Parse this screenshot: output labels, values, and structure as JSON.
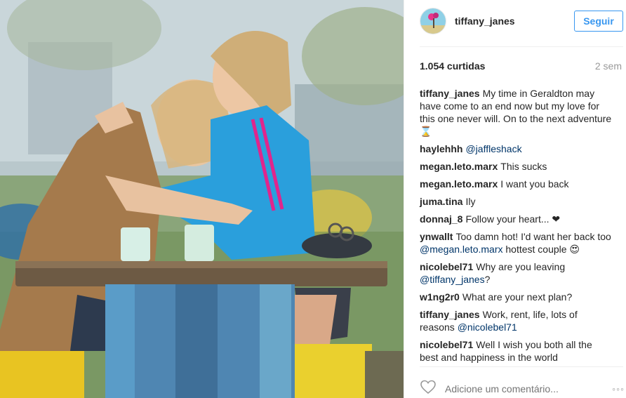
{
  "post": {
    "username": "tiffany_janes",
    "follow_label": "Seguir",
    "likes": "1.054 curtidas",
    "time": "2 sem",
    "comment_placeholder": "Adicione um comentário...",
    "more_label": "◦◦◦"
  },
  "icons": {
    "heart": "heart-outline-icon",
    "more": "more-options-icon"
  },
  "colors": {
    "follow": "#3897f0",
    "mention": "#003569",
    "muted": "#999999"
  },
  "comments": [
    {
      "user": "tiffany_janes",
      "text": "My time in Geraldton may have come to an end now but my love for this one never will. On to the next adventure ⌛",
      "mention": ""
    },
    {
      "user": "haylehhh",
      "text": "",
      "mention": "@jaffleshack"
    },
    {
      "user": "megan.leto.marx",
      "text": "This sucks",
      "mention": ""
    },
    {
      "user": "megan.leto.marx",
      "text": "I want you back",
      "mention": ""
    },
    {
      "user": "juma.tina",
      "text": "Ily",
      "mention": ""
    },
    {
      "user": "donnaj_8",
      "text": "Follow your heart... ❤",
      "mention": ""
    },
    {
      "user": "ynwallt",
      "text": "Too damn hot! I'd want her back too",
      "mention": "@megan.leto.marx",
      "after": "hottest couple 😍"
    },
    {
      "user": "nicolebel71",
      "text": "Why are you leaving",
      "mention": "@tiffany_janes",
      "after": "?"
    },
    {
      "user": "w1ng2r0",
      "text": "What are your next plan?",
      "mention": ""
    },
    {
      "user": "tiffany_janes",
      "text": "Work, rent, life, lots of reasons",
      "mention": "@nicolebel71"
    },
    {
      "user": "nicolebel71",
      "text": "Well I wish you both all the best and happiness in the world",
      "mention": ""
    }
  ]
}
